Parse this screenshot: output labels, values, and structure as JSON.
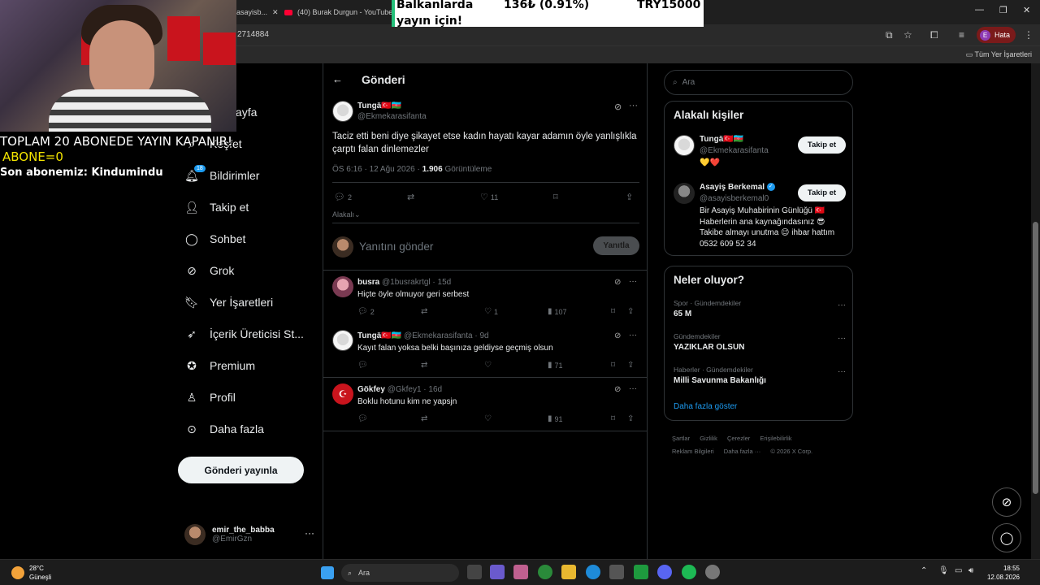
{
  "browser": {
    "tabs": [
      {
        "title": "asayisb..."
      },
      {
        "title": "(40) Burak Durgun - YouTube"
      }
    ],
    "url": "2714884",
    "profile_label": "Hata",
    "profile_initial": "E",
    "bookmarks_label": "Tüm Yer İşaretleri"
  },
  "stream": {
    "line1": "TOPLAM 20 ABONEDE YAYIN KAPANIR!",
    "line2": "ABONE=0",
    "line3": "Son abonemiz: Kindumindu",
    "ticker": {
      "left_top": "Balkanlarda",
      "left_bottom": "yayın için!",
      "amount": "136₺ (0.91%)",
      "goal": "TRY15000"
    }
  },
  "nav": {
    "items": [
      {
        "icon": "house-icon",
        "label": "Anasayfa"
      },
      {
        "icon": "search-icon",
        "label": "Keşfet"
      },
      {
        "icon": "bell-icon",
        "label": "Bildirimler",
        "badge": "18"
      },
      {
        "icon": "add-person-icon",
        "label": "Takip et"
      },
      {
        "icon": "chat-icon",
        "label": "Sohbet"
      },
      {
        "icon": "grok-icon",
        "label": "Grok"
      },
      {
        "icon": "bookmark-icon",
        "label": "Yer İşaretleri"
      },
      {
        "icon": "rocket-icon",
        "label": "İçerik Üreticisi St..."
      },
      {
        "icon": "premium-icon",
        "label": "Premium"
      },
      {
        "icon": "profile-icon",
        "label": "Profil"
      },
      {
        "icon": "more-circle-icon",
        "label": "Daha fazla"
      }
    ],
    "post_button": "Gönderi yayınla",
    "account": {
      "name": "emir_the_babba",
      "handle": "@EmirGzn"
    }
  },
  "main": {
    "title": "Gönderi",
    "post": {
      "name": "Tungä🇹🇷🇦🇿",
      "handle": "@Ekmekarasifanta",
      "text": "Taciz etti beni diye şikayet etse kadın hayatı kayar adamın öyle yanlışlıkla çarptı falan dinlemezler",
      "time": "ÖS 6:16 · 12 Ağu 2026 · ",
      "views": "1.906",
      "views_label": " Görüntüleme",
      "replies": "2",
      "likes": "11",
      "related": "Alakalı"
    },
    "reply_placeholder": "Yanıtını gönder",
    "reply_button": "Yanıtla",
    "replies": [
      {
        "name": "busra",
        "meta": "@1busrakrtgl · 15d",
        "text": "Hiçte öyle olmuyor geri serbest",
        "replies": "2",
        "likes": "1",
        "views": "107",
        "avatar": "busra"
      },
      {
        "name": "Tungä🇹🇷🇦🇿",
        "meta": "@Ekmekarasifanta · 9d",
        "text": "Kayıt falan yoksa belki başınıza geldiyse geçmiş olsun",
        "replies": "",
        "likes": "",
        "views": "71",
        "avatar": "tunga"
      },
      {
        "name": "Gökfey",
        "meta": "@Gkfey1 · 16d",
        "text": "Boklu hotunu kim ne yapsjn",
        "replies": "",
        "likes": "",
        "views": "91",
        "avatar": "gokfey"
      }
    ]
  },
  "sidebar": {
    "search_placeholder": "Ara",
    "people_title": "Alakalı kişiler",
    "people": [
      {
        "name": "Tungä🇹🇷🇦🇿",
        "handle": "@Ekmekarasifanta",
        "bio": "💛❤️",
        "follow": "Takip et"
      },
      {
        "name": "Asayiş Berkemal",
        "handle": "@asayisberkemal0",
        "bio": "Bir Asayiş Muhabirinin Günlüğü 🇹🇷 Haberlerin ana kaynağındasınız 😎 Takibe almayı unutma 😉 ihbar hattım 0532 609 52 34",
        "follow": "Takip et"
      }
    ],
    "trends_title": "Neler oluyor?",
    "trends": [
      {
        "category": "Spor · Gündemdekiler",
        "name": "65 M"
      },
      {
        "category": "Gündemdekiler",
        "name": "YAZIKLAR OLSUN"
      },
      {
        "category": "Haberler · Gündemdekiler",
        "name": "Milli Savunma Bakanlığı"
      }
    ],
    "show_more": "Daha fazla göster",
    "footer": [
      "Şartlar",
      "Gizlilik",
      "Çerezler",
      "Erişilebilirlik",
      "Reklam Bilgileri",
      "Daha fazla ···",
      "© 2026 X Corp."
    ]
  },
  "taskbar": {
    "temp": "28°C",
    "weather": "Güneşli",
    "search": "Ara",
    "time": "18:55",
    "date": "12.08.2026"
  }
}
